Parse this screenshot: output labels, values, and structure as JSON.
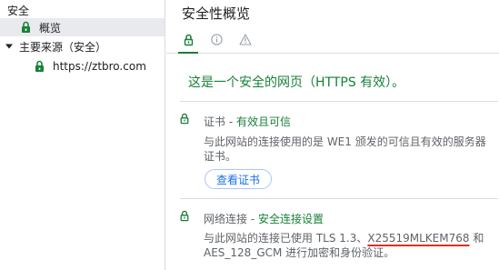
{
  "sidebar": {
    "heading": "安全",
    "items": [
      {
        "label": "概览",
        "selected": true,
        "icon": "lock-icon"
      },
      {
        "label": "主要来源（安全）",
        "expanded": true,
        "icon": "triangle-down-icon"
      },
      {
        "label": "https://ztbro.com",
        "icon": "lock-icon"
      }
    ]
  },
  "main": {
    "title": "安全性概览",
    "tabs": [
      {
        "icon": "lock-icon",
        "active": true
      },
      {
        "icon": "info-icon",
        "active": false
      },
      {
        "icon": "warning-icon",
        "active": false
      }
    ],
    "summary": "这是一个安全的网页（HTTPS 有效）。",
    "certificate": {
      "label": "证书",
      "separator": " - ",
      "status": "有效且可信",
      "description": "与此网站的连接使用的是 WE1 颁发的可信且有效的服务器证书。",
      "button": "查看证书"
    },
    "connection": {
      "label": "网络连接",
      "separator": " - ",
      "status": "安全连接设置",
      "description_prefix": "与此网站的连接已使用 TLS 1.3、",
      "key_exchange": "X25519MLKEM768",
      "description_middle": " 和",
      "description_suffix": "AES_128_GCM 进行加密和身份验证。"
    }
  },
  "colors": {
    "secure_green": "#188038",
    "text_secondary": "#5f6368",
    "link_blue": "#1a73e8",
    "selected_bg": "#e8eaed",
    "underline_red": "#d93025"
  }
}
